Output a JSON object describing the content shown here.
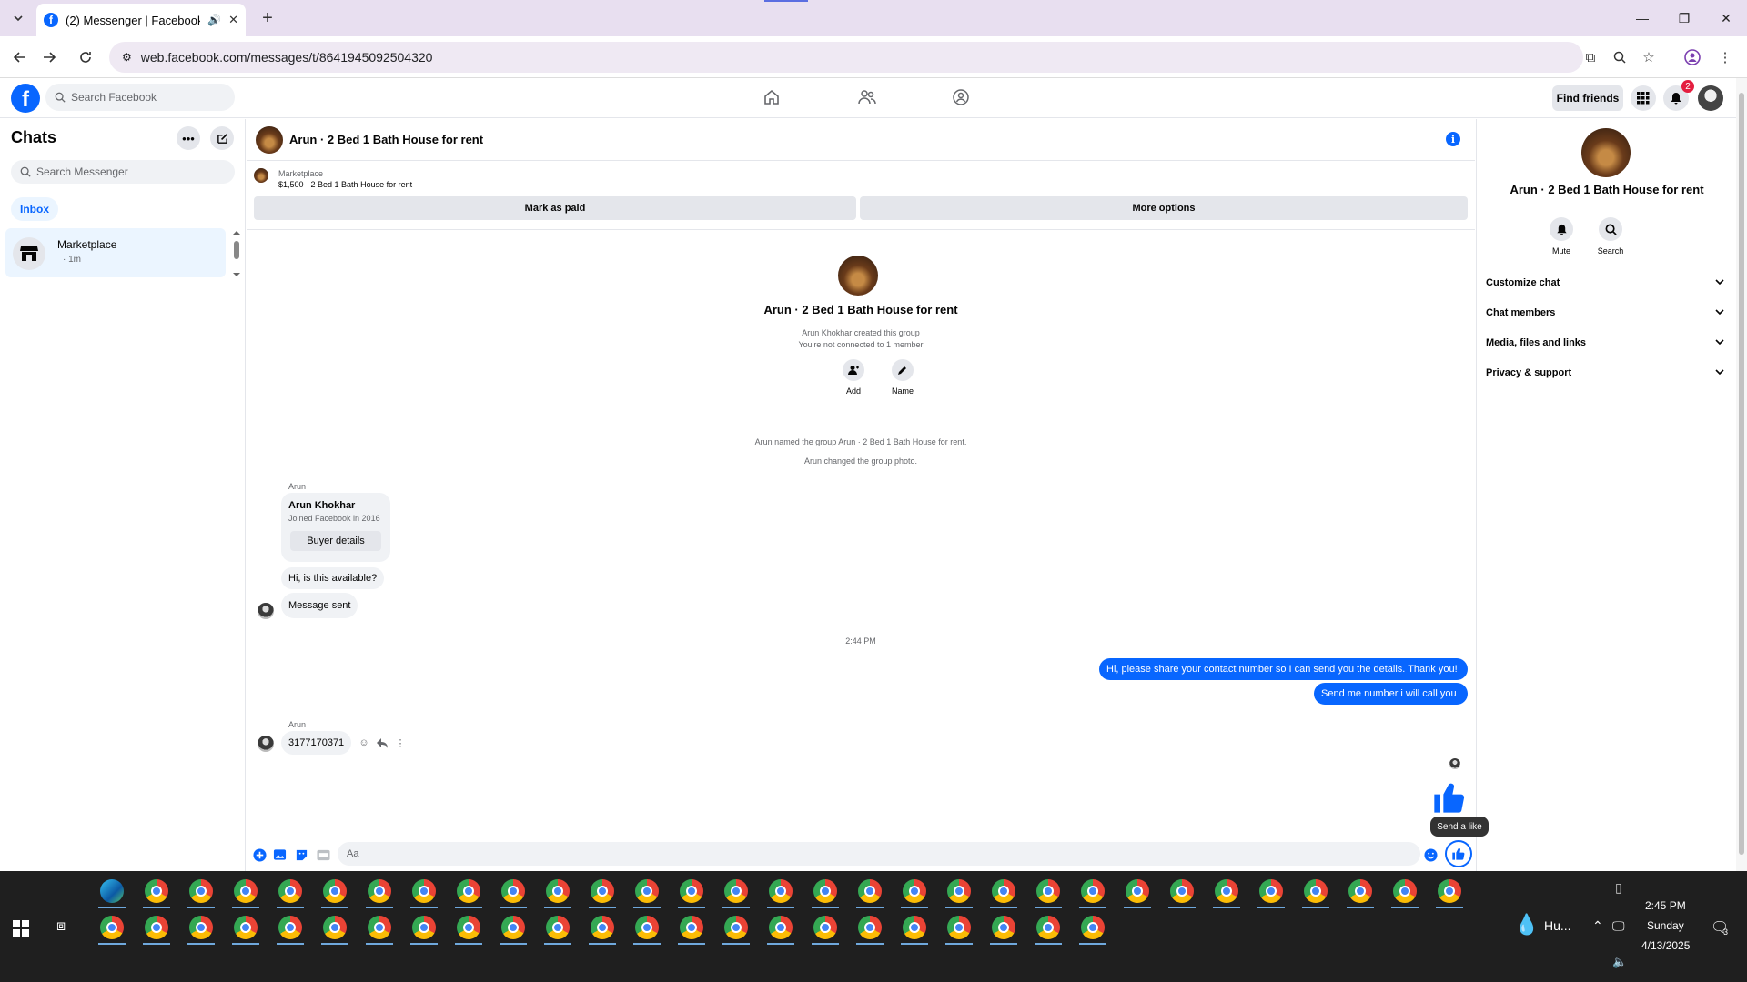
{
  "browser": {
    "tab_title": "(2) Messenger | Facebook",
    "url": "web.facebook.com/messages/t/8641945092504320",
    "new_tab_symbol": "+",
    "minimize_symbol": "—",
    "restore_symbol": "❐",
    "close_symbol": "✕"
  },
  "fb_header": {
    "logo_letter": "f",
    "search_placeholder": "Search Facebook",
    "find_friends_label": "Find friends",
    "notification_count": "2"
  },
  "chats_panel": {
    "title": "Chats",
    "search_placeholder": "Search Messenger",
    "filter_label": "Inbox",
    "items": [
      {
        "name": "Marketplace",
        "time": "· 1m"
      }
    ]
  },
  "conversation": {
    "title": "Arun · 2 Bed 1 Bath House for rent",
    "marketplace_label": "Marketplace",
    "listing_text": "$1,500 · 2 Bed 1 Bath House for rent",
    "mark_paid_label": "Mark as paid",
    "more_options_label": "More options",
    "group_name": "Arun · 2 Bed 1 Bath House for rent",
    "created_by": "Arun Khokhar created this group",
    "connection_note": "You're not connected to 1 member",
    "add_label": "Add",
    "name_label": "Name",
    "system_msg_1": "Arun named the group Arun · 2 Bed 1 Bath House for rent.",
    "system_msg_2": "Arun changed the group photo.",
    "sender_1": "Arun",
    "card_name": "Arun Khokhar",
    "card_joined": "Joined Facebook in 2016",
    "buyer_details_label": "Buyer details",
    "msg_available": "Hi, is this available?",
    "msg_sent": "Message sent",
    "time_separator": "2:44 PM",
    "out_msg_1": "Hi, please share your contact number so I can send you the details. Thank you!",
    "out_msg_2": "Send me number i will call you",
    "sender_2": "Arun",
    "msg_number": "3177170371",
    "tooltip": "Send a like",
    "composer_placeholder": "Aa"
  },
  "info_panel": {
    "title": "Arun · 2 Bed 1 Bath House for rent",
    "mute_label": "Mute",
    "search_label": "Search",
    "sections": [
      "Customize chat",
      "Chat members",
      "Media, files and links",
      "Privacy & support"
    ]
  },
  "taskbar": {
    "weather": "Hu...",
    "time": "2:45 PM",
    "day": "Sunday",
    "date": "4/13/2025",
    "notif_count": "3"
  },
  "colors": {
    "accent": "#0866ff",
    "tabbar": "#e8dff0",
    "taskbar": "#1f1f1f"
  }
}
